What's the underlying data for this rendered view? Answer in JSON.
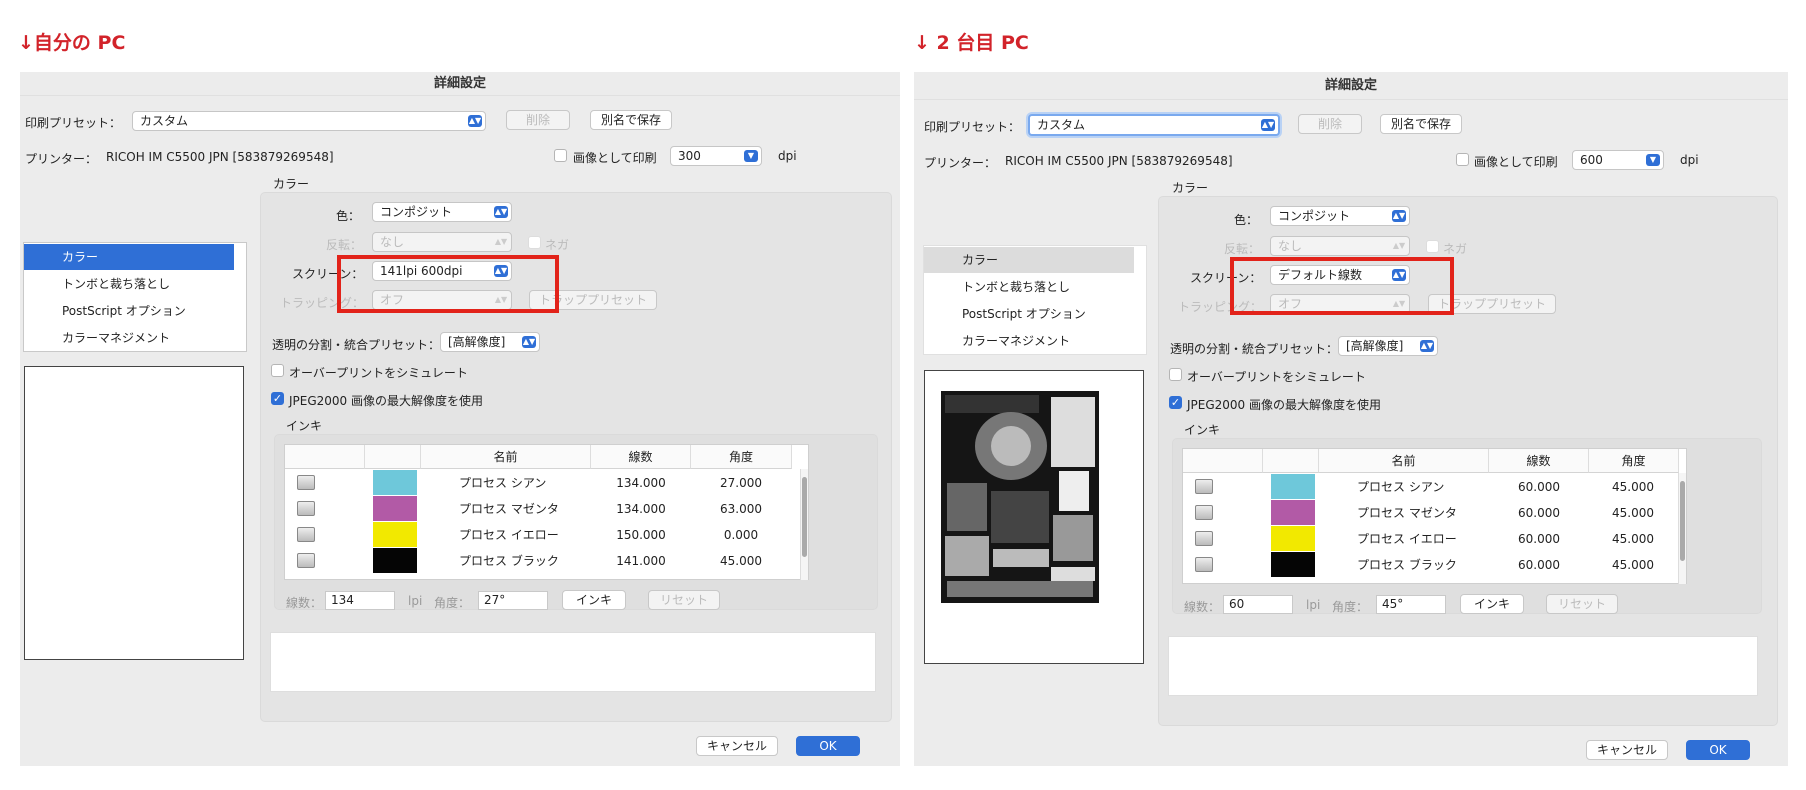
{
  "captions": {
    "left": "↓自分の PC",
    "right": "↓ 2 台目 PC"
  },
  "common": {
    "window_title": "詳細設定",
    "preset_label": "印刷プリセット：",
    "delete_label": "削除",
    "save_as_label": "別名で保存",
    "printer_label": "プリンター：",
    "printer_value": "RICOH IM C5500 JPN [583879269548]",
    "print_as_image_label": "画像として印刷",
    "dpi_label": "dpi",
    "color_group_label": "カラー",
    "color_label": "色：",
    "color_value": "コンポジット",
    "flip_label": "反転：",
    "flip_value": "なし",
    "negative_label": "ネガ",
    "screen_label": "スクリーン：",
    "trapping_label": "トラッピング：",
    "trapping_value": "オフ",
    "trap_preset_label": "トラッププリセット",
    "transparency_label": "透明の分割・統合プリセット：",
    "transparency_value": "[高解像度]",
    "overprint_label": "オーバープリントをシミュレート",
    "jpeg2000_label": "JPEG2000 画像の最大解像度を使用",
    "ink_group_label": "インキ",
    "ink_columns": [
      "名前",
      "線数",
      "角度"
    ],
    "sidebar_items": [
      "カラー",
      "トンボと裁ち落とし",
      "PostScript オプション",
      "カラーマネジメント"
    ],
    "lines_label": "線数：",
    "lpi_label": "lpi",
    "angle_label": "角度：",
    "ink_button": "インキ",
    "reset_button": "リセット",
    "cancel_button": "キャンセル",
    "ok_button": "OK",
    "swatch_colors": [
      "#6ec8da",
      "#b25aa6",
      "#f2e900",
      "#050505"
    ]
  },
  "left": {
    "preset_value": "カスタム",
    "dpi_value": "300",
    "screen_value": "141lpi 600dpi",
    "inks": [
      {
        "name": "プロセス シアン",
        "lines": "134.000",
        "angle": "27.000"
      },
      {
        "name": "プロセス マゼンタ",
        "lines": "134.000",
        "angle": "63.000"
      },
      {
        "name": "プロセス イエロー",
        "lines": "150.000",
        "angle": "0.000"
      },
      {
        "name": "プロセス ブラック",
        "lines": "141.000",
        "angle": "45.000"
      }
    ],
    "lines_value": "134",
    "angle_value": "27°"
  },
  "right": {
    "preset_value": "カスタム",
    "dpi_value": "600",
    "screen_value": "デフォルト線数",
    "inks": [
      {
        "name": "プロセス シアン",
        "lines": "60.000",
        "angle": "45.000"
      },
      {
        "name": "プロセス マゼンタ",
        "lines": "60.000",
        "angle": "45.000"
      },
      {
        "name": "プロセス イエロー",
        "lines": "60.000",
        "angle": "45.000"
      },
      {
        "name": "プロセス ブラック",
        "lines": "60.000",
        "angle": "45.000"
      }
    ],
    "lines_value": "60",
    "angle_value": "45°"
  }
}
